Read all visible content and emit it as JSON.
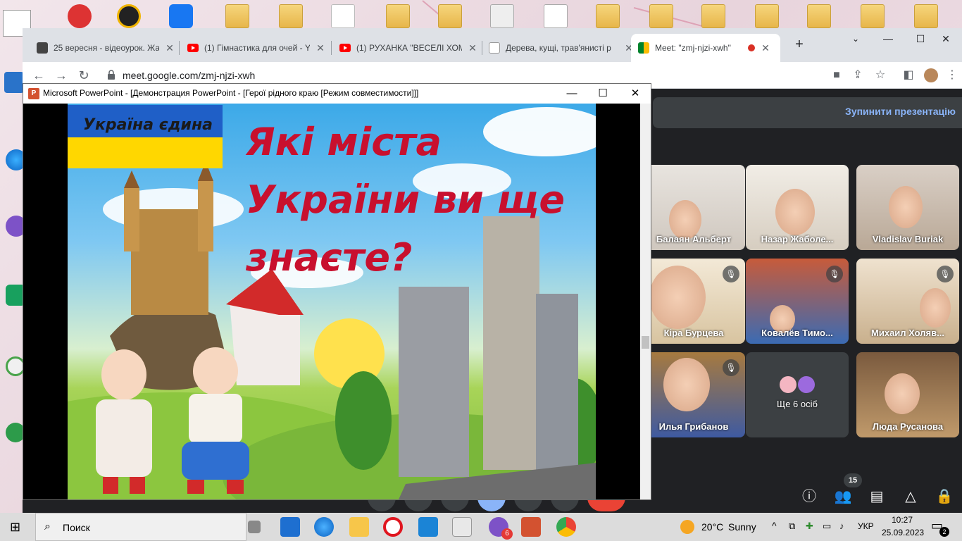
{
  "chrome": {
    "tabs": [
      {
        "title": "25 вересня - відеоурок. Жа",
        "favicon": "classroom-icon"
      },
      {
        "title": "(1) Гімнастика для очей - Yo",
        "favicon": "youtube-icon"
      },
      {
        "title": "(1) РУХАНКА \"ВЕСЕЛІ ХОМ'",
        "favicon": "youtube-icon"
      },
      {
        "title": "Дерева, кущі, трав'янисті р",
        "favicon": "doc-icon"
      },
      {
        "title": "Meet: \"zmj-njzi-xwh\"",
        "favicon": "meet-icon"
      }
    ],
    "url": "meet.google.com/zmj-njzi-xwh",
    "new_tab": "+",
    "window_controls": {
      "minimize": "—",
      "maximize": "☐",
      "close": "✕"
    },
    "nav": {
      "back": "←",
      "forward": "→",
      "reload": "↻"
    }
  },
  "meet": {
    "stop_presenting": "Зупинити презентацію",
    "participants": [
      {
        "name": "Балаян Альберт",
        "muted": false
      },
      {
        "name": "Назар Жаболе...",
        "muted": false
      },
      {
        "name": "Vladislav Buriak",
        "muted": false
      },
      {
        "name": "Кіра Бурцева",
        "muted": true
      },
      {
        "name": "Ковалёв Тимо...",
        "muted": true
      },
      {
        "name": "Михаил Холяв...",
        "muted": true
      },
      {
        "name": "Илья Грибанов",
        "muted": true
      },
      {
        "name": "Ще 6 осіб",
        "muted": false
      },
      {
        "name": "Люда Русанова",
        "muted": false
      }
    ],
    "participant_count": "15"
  },
  "powerpoint": {
    "title": "Microsoft PowerPoint - [Демонстрация PowerPoint - [Герої рідного краю [Режим совместимости]]]",
    "slide": {
      "flag_text": "Україна єдина",
      "heading_lines": [
        "Які міста",
        "України ви ще",
        "знаєте?"
      ]
    },
    "window_controls": {
      "minimize": "—",
      "maximize": "☐",
      "close": "✕"
    }
  },
  "taskbar": {
    "search": "Поиск",
    "weather": {
      "temp": "20°C",
      "condition": "Sunny"
    },
    "language": "УКР",
    "time": "10:27",
    "date": "25.09.2023",
    "notifications": "2",
    "viber_badge": "6"
  },
  "colors": {
    "heading_red": "#c8102e",
    "meet_bg": "#202124",
    "meet_link": "#8ab4f8",
    "flag_blue": "#1f5fc7",
    "flag_yellow": "#ffd700"
  }
}
